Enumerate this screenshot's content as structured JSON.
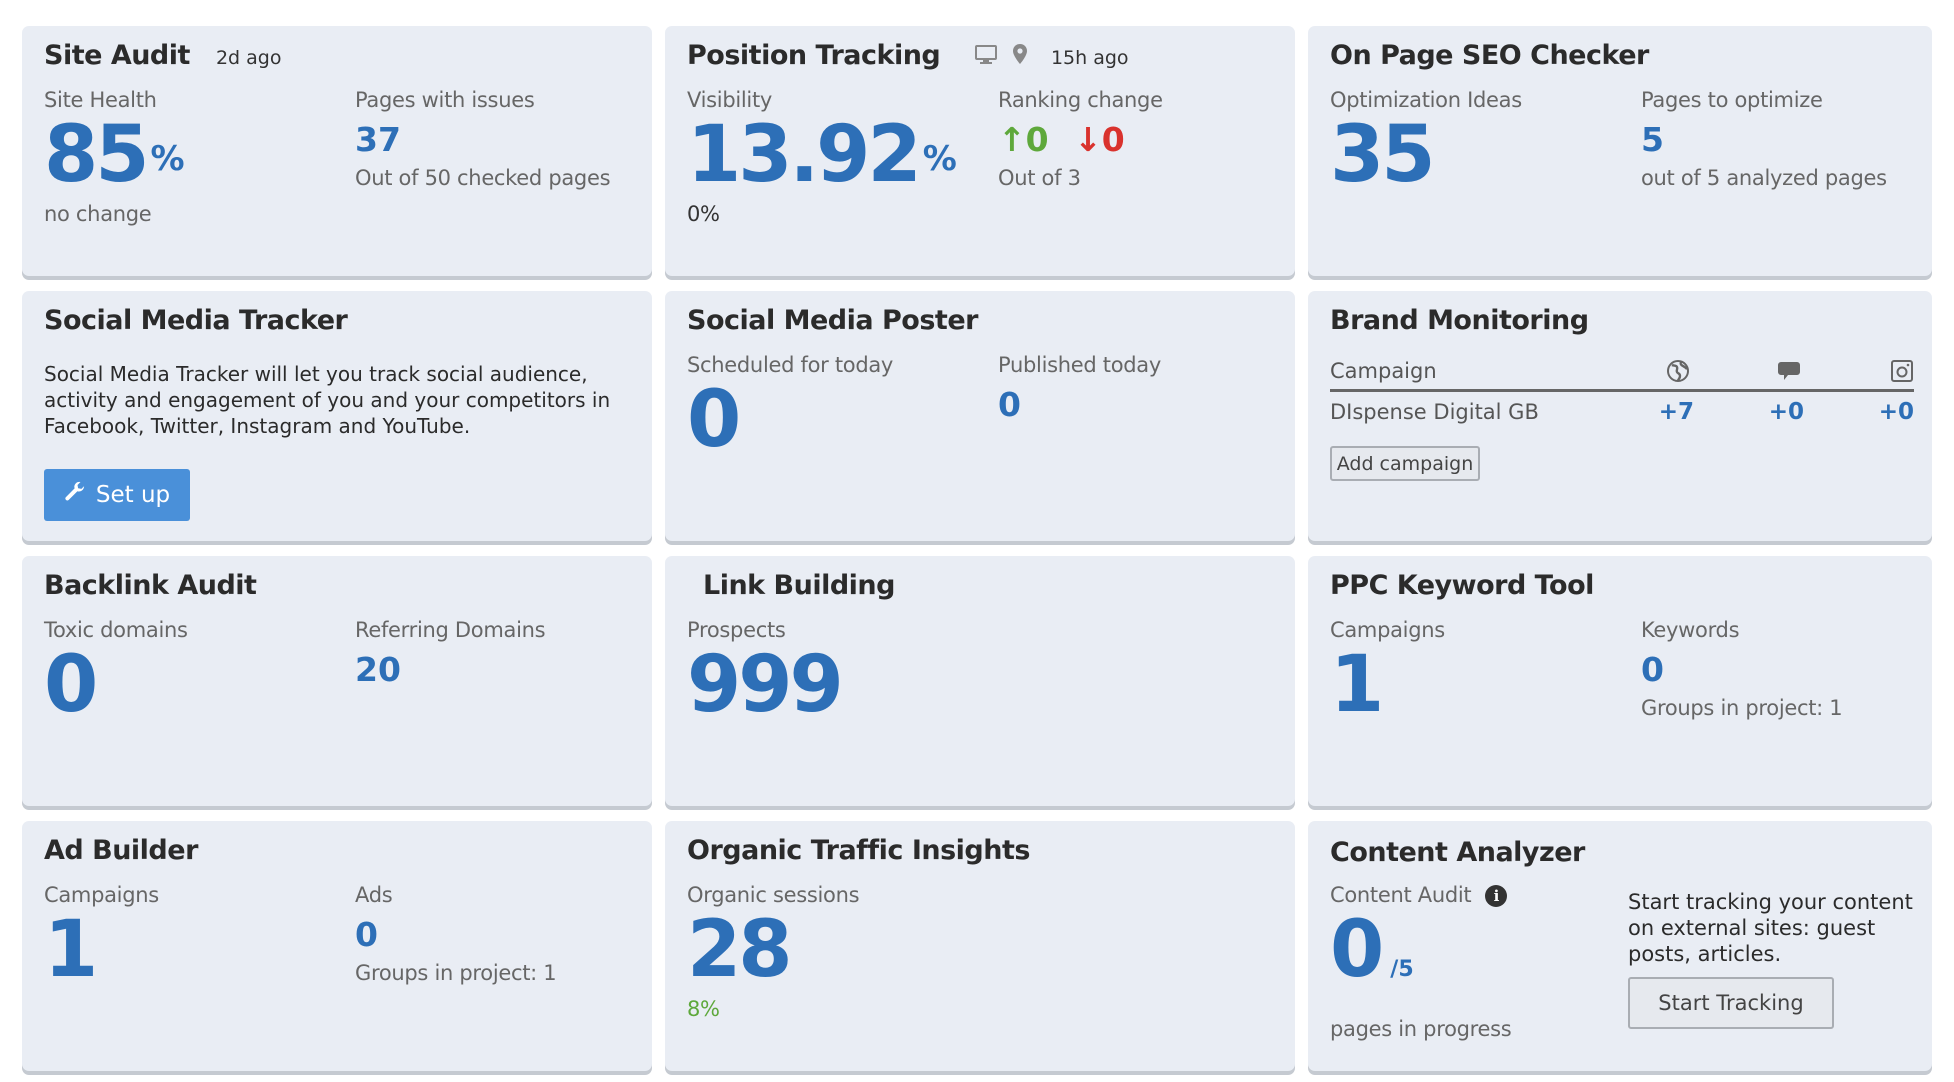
{
  "site_audit": {
    "title": "Site Audit",
    "updated": "2d ago",
    "health_label": "Site Health",
    "health_value": "85",
    "health_unit": "%",
    "health_change": "no change",
    "issues_label": "Pages with issues",
    "issues_value": "37",
    "issues_sub": "Out of 50 checked pages"
  },
  "position_tracking": {
    "title": "Position Tracking",
    "device_icon": "desktop-icon",
    "location_icon": "map-pin-icon",
    "updated": "15h ago",
    "visibility_label": "Visibility",
    "visibility_value": "13.92",
    "visibility_unit": "%",
    "visibility_change": "0%",
    "ranking_label": "Ranking change",
    "ranking_up": "0",
    "ranking_down": "0",
    "ranking_sub": "Out of 3"
  },
  "on_page_seo": {
    "title": "On Page SEO Checker",
    "ideas_label": "Optimization Ideas",
    "ideas_value": "35",
    "pages_label": "Pages to optimize",
    "pages_value": "5",
    "pages_sub": "out of 5 analyzed pages"
  },
  "social_media_tracker": {
    "title": "Social Media Tracker",
    "description": "Social Media Tracker will let you track social audience, activity and engagement of you and your competitors in Facebook, Twitter, Instagram and YouTube.",
    "setup_label": "Set up"
  },
  "social_media_poster": {
    "title": "Social Media Poster",
    "scheduled_label": "Scheduled for today",
    "scheduled_value": "0",
    "published_label": "Published today",
    "published_value": "0"
  },
  "brand_monitoring": {
    "title": "Brand Monitoring",
    "column_campaign": "Campaign",
    "column_icons": [
      "globe-icon",
      "comment-icon",
      "instagram-icon"
    ],
    "rows": [
      {
        "name": "DIspense Digital GB",
        "web": "+7",
        "mentions": "+0",
        "instagram": "+0"
      }
    ],
    "add_label": "Add campaign"
  },
  "backlink_audit": {
    "title": "Backlink Audit",
    "toxic_label": "Toxic domains",
    "toxic_value": "0",
    "referring_label": "Referring Domains",
    "referring_value": "20"
  },
  "link_building": {
    "title": "Link Building",
    "prospects_label": "Prospects",
    "prospects_value": "999"
  },
  "ppc_keyword_tool": {
    "title": "PPC Keyword Tool",
    "campaigns_label": "Campaigns",
    "campaigns_value": "1",
    "keywords_label": "Keywords",
    "keywords_value": "0",
    "keywords_sub": "Groups in project: 1"
  },
  "ad_builder": {
    "title": "Ad Builder",
    "campaigns_label": "Campaigns",
    "campaigns_value": "1",
    "ads_label": "Ads",
    "ads_value": "0",
    "ads_sub": "Groups in project: 1"
  },
  "organic_traffic": {
    "title": "Organic Traffic Insights",
    "sessions_label": "Organic sessions",
    "sessions_value": "28",
    "sessions_change": "8%"
  },
  "content_analyzer": {
    "title": "Content Analyzer",
    "audit_label": "Content Audit",
    "audit_value": "0",
    "audit_total": "/5",
    "audit_sub": "pages in progress",
    "tracking_text": "Start tracking your content on external sites: guest posts, articles.",
    "tracking_button": "Start Tracking"
  },
  "colors": {
    "card_bg": "#e9edf4",
    "accent_blue": "#2d6fb7",
    "button_blue": "#4a90d9",
    "positive_green": "#5ea83b",
    "negative_red": "#d9322d"
  }
}
